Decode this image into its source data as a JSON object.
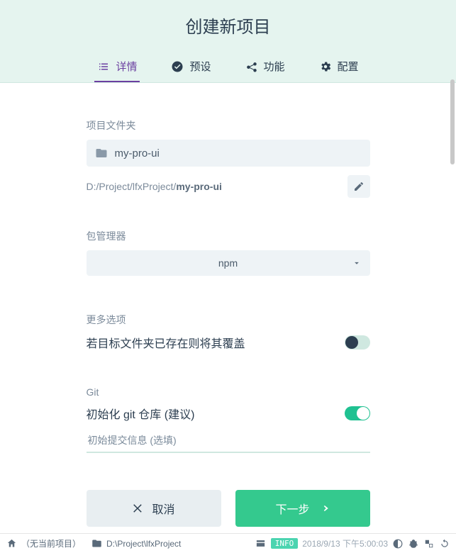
{
  "header": {
    "title": "创建新项目",
    "tabs": [
      {
        "label": "详情",
        "icon": "list-icon",
        "active": true
      },
      {
        "label": "预设",
        "icon": "check-circle-icon",
        "active": false
      },
      {
        "label": "功能",
        "icon": "share-icon",
        "active": false
      },
      {
        "label": "配置",
        "icon": "settings-icon",
        "active": false
      }
    ]
  },
  "form": {
    "projectFolder": {
      "label": "项目文件夹",
      "name": "my-pro-ui",
      "pathPrefix": "D:/Project/lfxProject/",
      "pathBold": "my-pro-ui"
    },
    "packageManager": {
      "label": "包管理器",
      "value": "npm"
    },
    "moreOptions": {
      "label": "更多选项",
      "overwrite": {
        "label": "若目标文件夹已存在则将其覆盖",
        "value": false
      }
    },
    "git": {
      "label": "Git",
      "initLabel": "初始化 git 仓库 (建议)",
      "initValue": true,
      "commitPlaceholder": "初始提交信息 (选填)"
    }
  },
  "buttons": {
    "cancel": "取消",
    "next": "下一步"
  },
  "statusbar": {
    "noProject": "（无当前项目）",
    "path": "D:\\Project\\lfxProject",
    "logLevel": "INFO",
    "datetime": "2018/9/13 下午5:00:03"
  }
}
